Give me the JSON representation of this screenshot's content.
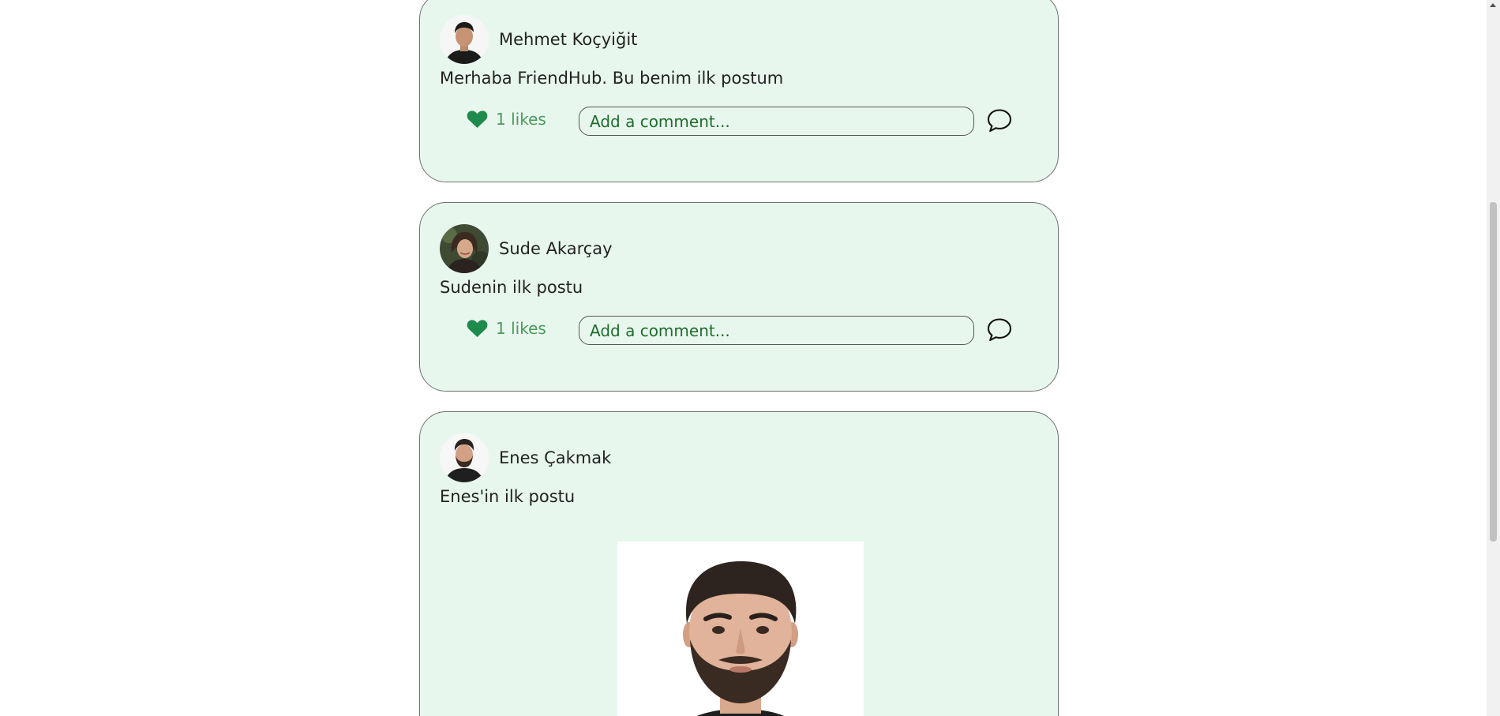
{
  "colors": {
    "card_background": "#e8f7ee",
    "card_border": "#707070",
    "heart": "#1e8a4c",
    "likes_text": "#4a9a5b",
    "comment_text": "#1f6b2c"
  },
  "posts": [
    {
      "user": "Mehmet Koçyiğit",
      "text": "Merhaba FriendHub. Bu benim ilk postum",
      "likes": "1 likes",
      "comment_placeholder": "Add a comment...",
      "avatar_icon": "profile-photo",
      "comment_icon": "speech-bubble-icon",
      "like_icon": "heart-icon"
    },
    {
      "user": "Sude Akarçay",
      "text": "Sudenin ilk postu",
      "likes": "1 likes",
      "comment_placeholder": "Add a comment...",
      "avatar_icon": "profile-photo",
      "comment_icon": "speech-bubble-icon",
      "like_icon": "heart-icon"
    },
    {
      "user": "Enes Çakmak",
      "text": "Enes'in ilk postu",
      "avatar_icon": "profile-photo",
      "image": "portrait-photo"
    }
  ]
}
